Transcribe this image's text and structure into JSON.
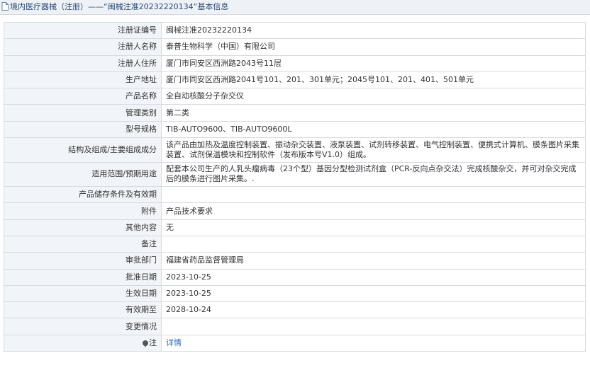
{
  "header": {
    "title": "境内医疗器械（注册）——“闽械注准20232220134”基本信息"
  },
  "rows": [
    {
      "label": "注册证编号",
      "value": "闽械注准20232220134"
    },
    {
      "label": "注册人名称",
      "value": "泰普生物科学（中国）有限公司"
    },
    {
      "label": "注册人住所",
      "value": "厦门市同安区西洲路2043号11层"
    },
    {
      "label": "生产地址",
      "value": "厦门市同安区西洲路2041号101、201、301单元；2045号101、201、401、501单元"
    },
    {
      "label": "产品名称",
      "value": "全自动核酸分子杂交仪"
    },
    {
      "label": "管理类别",
      "value": "第二类"
    },
    {
      "label": "型号规格",
      "value": "TIB-AUTO9600、TIB-AUTO9600L"
    },
    {
      "label": "结构及组成/主要组成成分",
      "value": "该产品由加热及温度控制装置、振动杂交装置、液泵装置、试剂转移装置、电气控制装置、便携式计算机、膜条图片采集装置、试剂保温模块和控制软件（发布版本号V1.0）组成。"
    },
    {
      "label": "适用范围/预期用途",
      "value": "配套本公司生产的人乳头瘤病毒（23个型）基因分型检测试剂盒（PCR-反向点杂交法）完成核酸杂交，并可对杂交完成后的膜条进行图片采集。."
    },
    {
      "label": "产品储存条件及有效期",
      "value": ""
    },
    {
      "label": "附件",
      "value": "产品技术要求"
    },
    {
      "label": "其他内容",
      "value": "无"
    },
    {
      "label": "备注",
      "value": ""
    },
    {
      "label": "审批部门",
      "value": "福建省药品监督管理局"
    },
    {
      "label": "批准日期",
      "value": "2023-10-25"
    },
    {
      "label": "生效日期",
      "value": "2023-10-25"
    },
    {
      "label": "有效期至",
      "value": "2028-10-24"
    },
    {
      "label": "变更情况",
      "value": ""
    }
  ],
  "note": {
    "label": "注",
    "link_text": "详情",
    "icon": "pin-icon"
  },
  "colors": {
    "header_bg": "#eef1f5",
    "header_text": "#2b4a78",
    "label_bg": "#f1f4f8",
    "border": "#d6dbe2",
    "link": "#2a6ab8"
  }
}
